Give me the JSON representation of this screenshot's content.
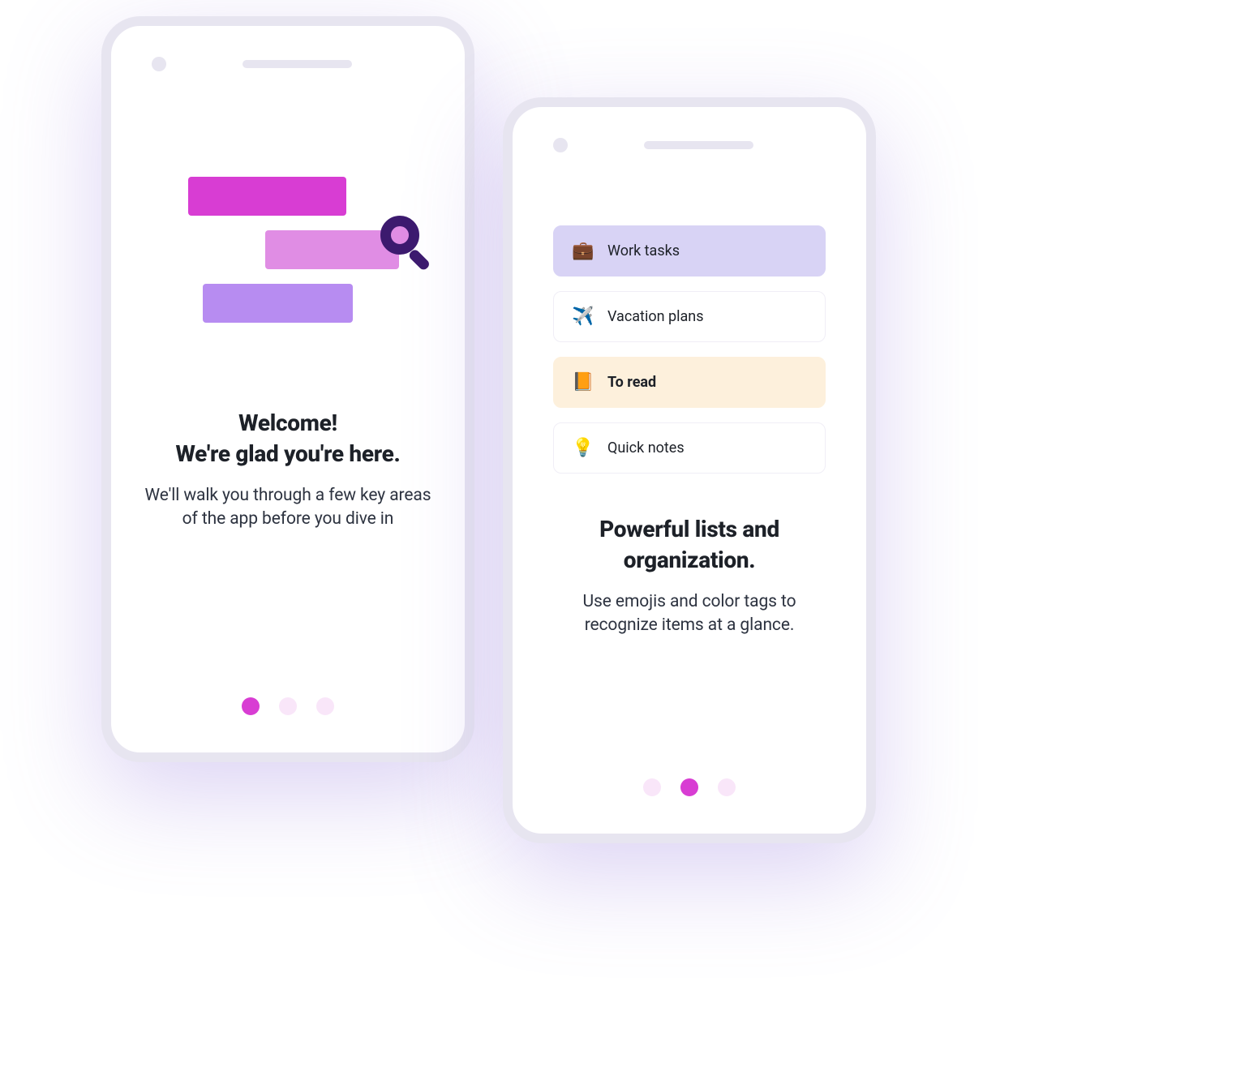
{
  "phone1": {
    "title_line1": "Welcome!",
    "title_line2": "We're glad you're here.",
    "subtitle": "We'll walk you through a few key areas of the app before you dive in",
    "active_dot": 0,
    "total_dots": 3
  },
  "phone2": {
    "title_line1": "Powerful lists and",
    "title_line2": "organization.",
    "subtitle": "Use emojis and color tags to recognize items at a glance.",
    "active_dot": 1,
    "total_dots": 3,
    "list_items": [
      {
        "emoji": "💼",
        "label": "Work tasks",
        "style": "highlight-purple"
      },
      {
        "emoji": "✈️",
        "label": "Vacation plans",
        "style": ""
      },
      {
        "emoji": "📙",
        "label": "To read",
        "style": "highlight-orange"
      },
      {
        "emoji": "💡",
        "label": "Quick notes",
        "style": ""
      }
    ]
  }
}
